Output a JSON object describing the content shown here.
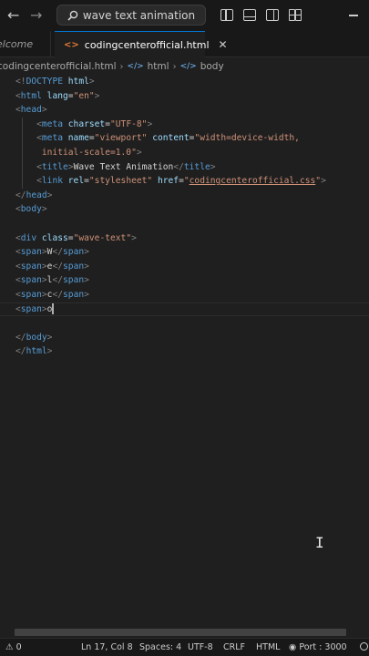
{
  "titlebar": {
    "back_glyph": "←",
    "forward_glyph": "→",
    "search_text": "wave text animation"
  },
  "tabs": [
    {
      "label": "elcome"
    },
    {
      "label": "codingcenterofficial.html"
    }
  ],
  "breadcrumb": {
    "file": "codingcenterofficial.html",
    "sep": "›",
    "item1": "html",
    "item2": "body"
  },
  "editor": {
    "lines": [
      "<!DOCTYPE html>",
      "<html lang=\"en\">",
      "<head>",
      "    <meta charset=\"UTF-8\">",
      "    <meta name=\"viewport\" content=\"width=device-width,",
      "     initial-scale=1.0\">",
      "    <title>Wave Text Animation</title>",
      "    <link rel=\"stylesheet\" href=\"codingcenterofficial.css\">",
      "</head>",
      "<body>",
      "",
      "<div class=\"wave-text\">",
      "<span>W</span>",
      "<span>e</span>",
      "<span>l</span>",
      "<span>c</span>",
      "<span>o",
      "",
      "</body>",
      "</html>"
    ],
    "current_line": 17
  },
  "statusbar": {
    "problems": "0",
    "position": "Ln 17, Col 8",
    "spaces": "Spaces: 4",
    "encoding": "UTF-8",
    "eol": "CRLF",
    "language": "HTML",
    "port": "Port : 3000"
  }
}
